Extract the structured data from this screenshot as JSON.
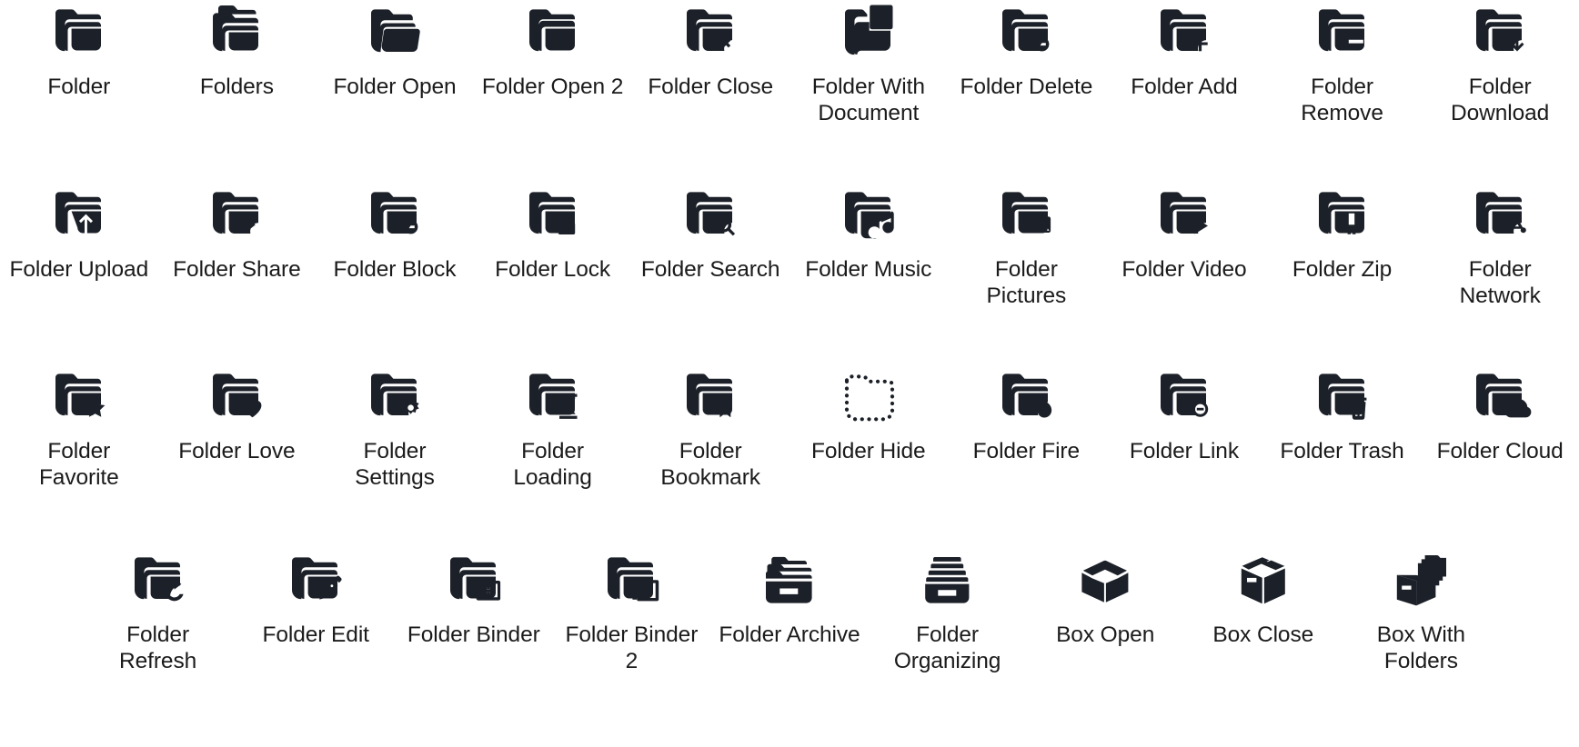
{
  "sheet": {
    "background_color": "#ffffff",
    "icon_color": "#1c2028",
    "label_color": "#1b1b1b",
    "columns": 10,
    "rows": 4
  },
  "rows": [
    {
      "index": 1,
      "items": [
        {
          "label": "Folder",
          "icon": "folder-icon"
        },
        {
          "label": "Folders",
          "icon": "folders-icon"
        },
        {
          "label": "Folder Open",
          "icon": "folder-open-icon"
        },
        {
          "label": "Folder Open 2",
          "icon": "folder-open-2-icon"
        },
        {
          "label": "Folder Close",
          "icon": "folder-close-icon"
        },
        {
          "label": "Folder With Document",
          "icon": "folder-with-document-icon"
        },
        {
          "label": "Folder Delete",
          "icon": "folder-delete-icon"
        },
        {
          "label": "Folder Add",
          "icon": "folder-add-icon"
        },
        {
          "label": "Folder Remove",
          "icon": "folder-remove-icon"
        },
        {
          "label": "Folder Download",
          "icon": "folder-download-icon"
        }
      ]
    },
    {
      "index": 2,
      "items": [
        {
          "label": "Folder Upload",
          "icon": "folder-upload-icon"
        },
        {
          "label": "Folder Share",
          "icon": "folder-share-icon"
        },
        {
          "label": "Folder Block",
          "icon": "folder-block-icon"
        },
        {
          "label": "Folder Lock",
          "icon": "folder-lock-icon"
        },
        {
          "label": "Folder Search",
          "icon": "folder-search-icon"
        },
        {
          "label": "Folder Music",
          "icon": "folder-music-icon"
        },
        {
          "label": "Folder Pictures",
          "icon": "folder-pictures-icon"
        },
        {
          "label": "Folder Video",
          "icon": "folder-video-icon"
        },
        {
          "label": "Folder Zip",
          "icon": "folder-zip-icon"
        },
        {
          "label": "Folder Network",
          "icon": "folder-network-icon"
        }
      ]
    },
    {
      "index": 3,
      "items": [
        {
          "label": "Folder Favorite",
          "icon": "folder-favorite-icon"
        },
        {
          "label": "Folder Love",
          "icon": "folder-love-icon"
        },
        {
          "label": "Folder Settings",
          "icon": "folder-settings-icon"
        },
        {
          "label": "Folder Loading",
          "icon": "folder-loading-icon"
        },
        {
          "label": "Folder Bookmark",
          "icon": "folder-bookmark-icon"
        },
        {
          "label": "Folder Hide",
          "icon": "folder-hide-icon"
        },
        {
          "label": "Folder Fire",
          "icon": "folder-fire-icon"
        },
        {
          "label": "Folder Link",
          "icon": "folder-link-icon"
        },
        {
          "label": "Folder Trash",
          "icon": "folder-trash-icon"
        },
        {
          "label": "Folder Cloud",
          "icon": "folder-cloud-icon"
        }
      ]
    },
    {
      "index": 4,
      "items": [
        {
          "label": "Folder Refresh",
          "icon": "folder-refresh-icon"
        },
        {
          "label": "Folder Edit",
          "icon": "folder-edit-icon"
        },
        {
          "label": "Folder Binder",
          "icon": "folder-binder-icon"
        },
        {
          "label": "Folder Binder 2",
          "icon": "folder-binder-2-icon"
        },
        {
          "label": "Folder Archive",
          "icon": "folder-archive-icon"
        },
        {
          "label": "Folder Organizing",
          "icon": "folder-organizing-icon"
        },
        {
          "label": "Box Open",
          "icon": "box-open-icon"
        },
        {
          "label": "Box Close",
          "icon": "box-close-icon"
        },
        {
          "label": "Box With Folders",
          "icon": "box-with-folders-icon"
        }
      ]
    }
  ]
}
